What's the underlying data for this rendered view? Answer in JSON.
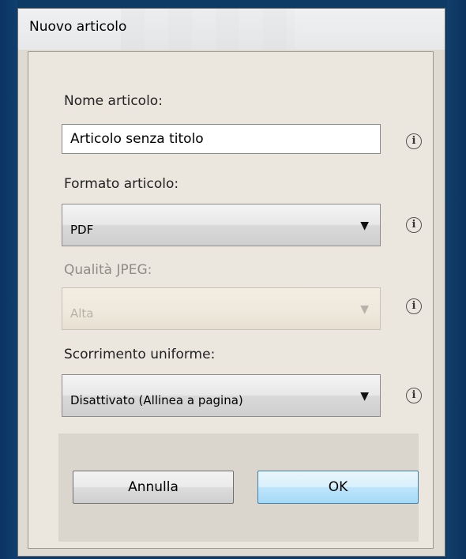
{
  "dialog": {
    "title": "Nuovo articolo",
    "fields": {
      "name": {
        "label": "Nome articolo:",
        "value": "Articolo senza titolo"
      },
      "format": {
        "label": "Formato articolo:",
        "value": "PDF"
      },
      "jpeg_quality": {
        "label": "Qualità JPEG:",
        "value": "Alta",
        "enabled": false
      },
      "smooth_scroll": {
        "label": "Scorrimento uniforme:",
        "value": "Disattivato (Allinea a pagina)"
      }
    },
    "info_icon_glyph": "i",
    "dropdown_arrow": "▼",
    "buttons": {
      "cancel": "Annulla",
      "ok": "OK"
    }
  }
}
